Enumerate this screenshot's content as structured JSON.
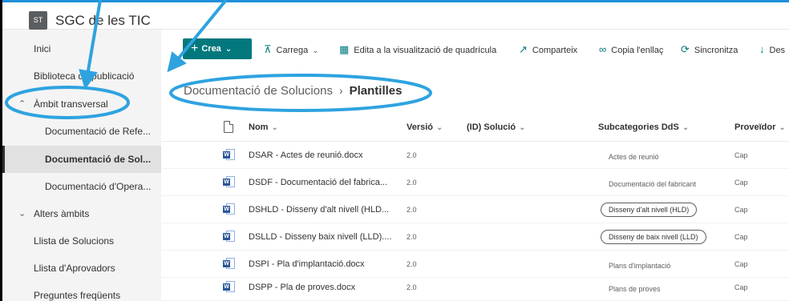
{
  "site": {
    "logo_initials": "ST",
    "title": "SGC de les TIC"
  },
  "sidebar": {
    "items": [
      {
        "label": "Inici"
      },
      {
        "label": "Biblioteca de publicació"
      },
      {
        "label": "Àmbit transversal"
      },
      {
        "label": "Documentació de Refe..."
      },
      {
        "label": "Documentació de Sol..."
      },
      {
        "label": "Documentació d'Opera..."
      },
      {
        "label": "Alters àmbits"
      },
      {
        "label": "Llista de Solucions"
      },
      {
        "label": "Llista d'Aprovadors"
      },
      {
        "label": "Preguntes freqüents"
      }
    ]
  },
  "toolbar": {
    "new_label": "Crea",
    "upload_label": "Carrega",
    "grid_edit_label": "Edita a la visualització de quadrícula",
    "share_label": "Comparteix",
    "copy_link_label": "Copia l'enllaç",
    "sync_label": "Sincronitza",
    "download_label": "Des"
  },
  "breadcrumb": {
    "parent": "Documentació de Solucions",
    "current": "Plantilles"
  },
  "table": {
    "columns": {
      "name": "Nom",
      "version": "Versió",
      "solution_id": "(ID) Solució",
      "subcategories": "Subcategories DdS",
      "provider": "Proveïdor"
    },
    "rows": [
      {
        "name": "DSAR - Actes de reunió.docx",
        "version": "2.0",
        "subcategory": "Actes de reunió",
        "provider": "Cap"
      },
      {
        "name": "DSDF - Documentació del fabrica...",
        "version": "2.0",
        "subcategory": "Documentació del fabricant",
        "provider": "Cap"
      },
      {
        "name": "DSHLD - Disseny d'alt nivell (HLD...",
        "version": "2.0",
        "subcategory": "Disseny d'alt nivell (HLD)",
        "provider": "Cap"
      },
      {
        "name": "DSLLD - Disseny baix nivell (LLD)....",
        "version": "2.0",
        "subcategory": "Disseny de baix nivell (LLD)",
        "provider": "Cap"
      },
      {
        "name": "DSPI - Pla d'implantació.docx",
        "version": "2.0",
        "subcategory": "Plans d'implantació",
        "provider": "Cap"
      },
      {
        "name": "DSPP - Pla de proves.docx",
        "version": "2.0",
        "subcategory": "Plans de proves",
        "provider": "Cap"
      }
    ]
  },
  "annotation": {
    "color": "#2ea3e0"
  }
}
